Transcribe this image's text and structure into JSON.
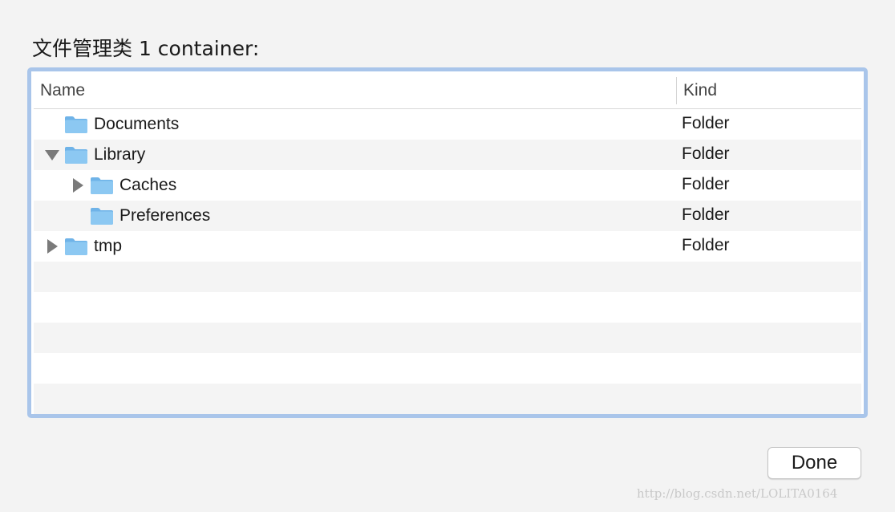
{
  "dialog": {
    "title": "文件管理类 1 container:"
  },
  "table": {
    "columns": {
      "name": "Name",
      "kind": "Kind"
    },
    "rows": [
      {
        "name": "Documents",
        "kind": "Folder",
        "level": 0,
        "disclosure": "none"
      },
      {
        "name": "Library",
        "kind": "Folder",
        "level": 0,
        "disclosure": "expanded"
      },
      {
        "name": "Caches",
        "kind": "Folder",
        "level": 1,
        "disclosure": "collapsed"
      },
      {
        "name": "Preferences",
        "kind": "Folder",
        "level": 1,
        "disclosure": "none"
      },
      {
        "name": "tmp",
        "kind": "Folder",
        "level": 0,
        "disclosure": "collapsed"
      }
    ],
    "empty_row_count": 5
  },
  "footer": {
    "done_label": "Done"
  },
  "watermark": "http://blog.csdn.net/LOLITA0164",
  "colors": {
    "focus_ring": "#a9c5ea",
    "folder_blue": "#8cc8f2",
    "row_alt": "#f4f4f4",
    "disclosure_gray": "#7a7a7a"
  },
  "icons": {
    "folder": "folder-icon",
    "expanded": "disclosure-triangle-down-icon",
    "collapsed": "disclosure-triangle-right-icon"
  }
}
